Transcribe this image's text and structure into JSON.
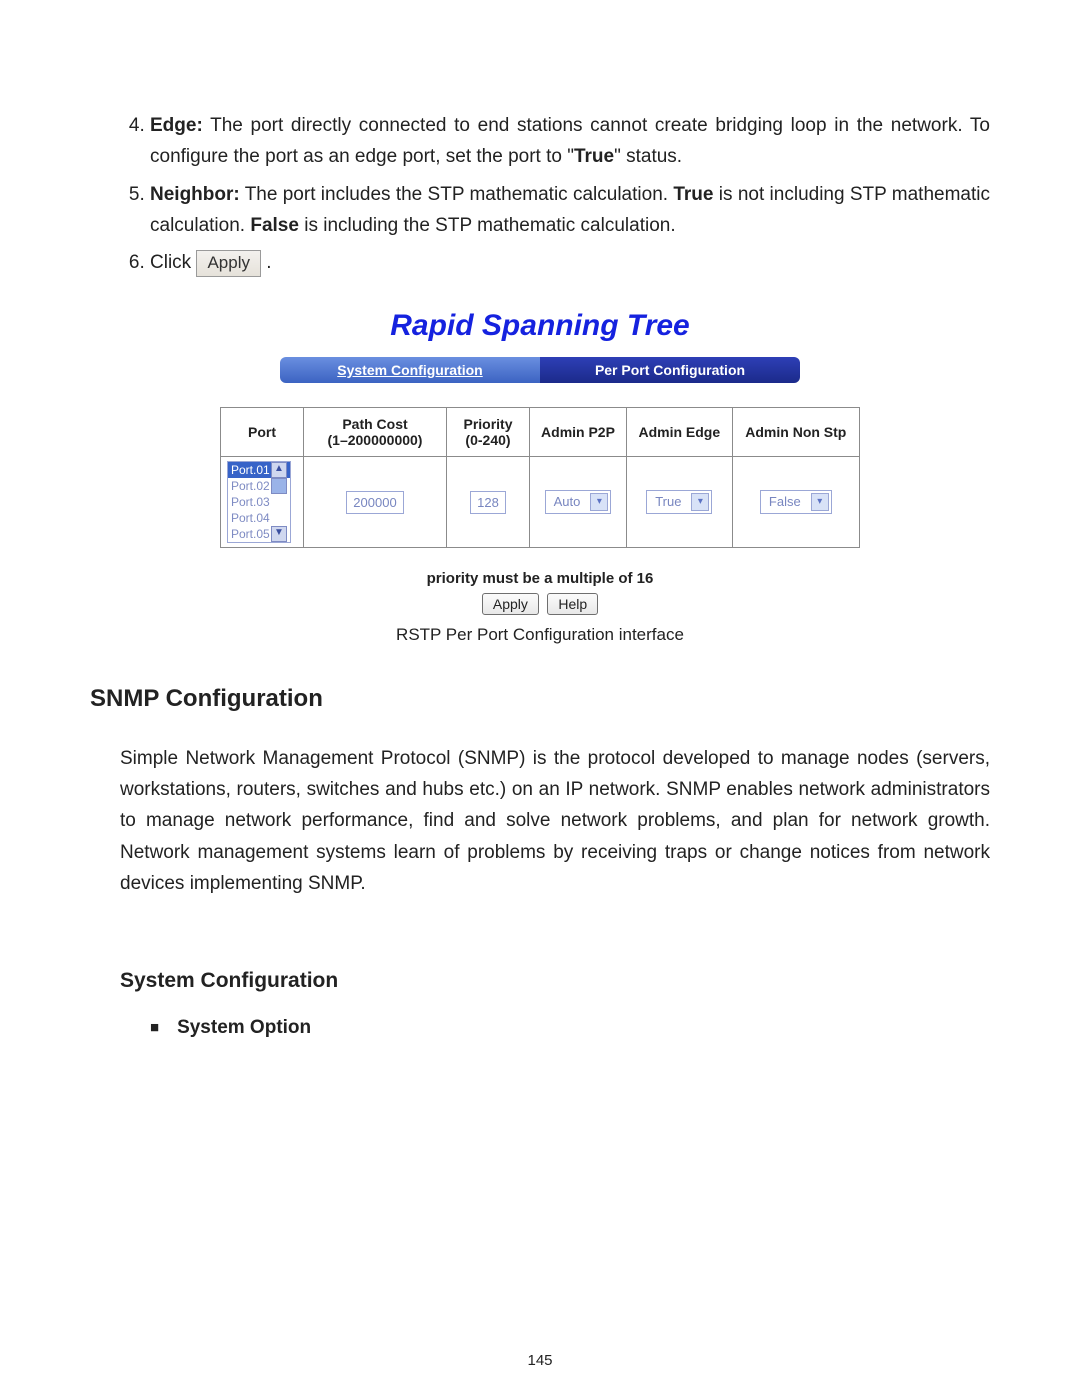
{
  "list": {
    "start": 4,
    "item4_label": "Edge:",
    "item4_text_a": " The port directly connected to end stations cannot create bridging loop in the network. To configure the port as an edge port, set the port to \"",
    "item4_bold_true": "True",
    "item4_text_b": "\" status.",
    "item5_label": "Neighbor:",
    "item5_text_a": " The port includes the STP mathematic calculation. ",
    "item5_true": "True",
    "item5_text_b": " is not including STP mathematic calculation. ",
    "item5_false": "False",
    "item5_text_c": " is including the STP mathematic calculation.",
    "item6_text_a": "Click ",
    "item6_btn": "Apply",
    "item6_text_b": " ."
  },
  "ui": {
    "title": "Rapid Spanning Tree",
    "tabs": {
      "left": "System Configuration",
      "right": "Per Port Configuration"
    },
    "th": {
      "port": "Port",
      "pathcost": "Path Cost",
      "pathcost_range": "(1–200000000)",
      "priority": "Priority",
      "priority_range": "(0-240)",
      "p2p": "Admin P2P",
      "edge": "Admin Edge",
      "nonstp": "Admin Non Stp"
    },
    "ports": [
      "Port.01",
      "Port.02",
      "Port.03",
      "Port.04",
      "Port.05"
    ],
    "values": {
      "pathcost": "200000",
      "priority": "128",
      "p2p": "Auto",
      "edge": "True",
      "nonstp": "False"
    },
    "note": "priority must be a multiple of 16",
    "buttons": {
      "apply": "Apply",
      "help": "Help"
    }
  },
  "caption": "RSTP Per Port Configuration interface",
  "sections": {
    "snmp_heading": "SNMP Configuration",
    "snmp_body": "Simple Network Management Protocol (SNMP) is the protocol developed to manage nodes (servers, workstations, routers, switches and hubs etc.) on an IP network. SNMP enables network administrators to manage network performance, find and solve network problems, and plan for network growth. Network management systems learn of problems by receiving traps or change notices from network devices implementing SNMP.",
    "syscfg_heading": "System Configuration",
    "sysopt_heading": "System Option"
  },
  "page_number": "145"
}
